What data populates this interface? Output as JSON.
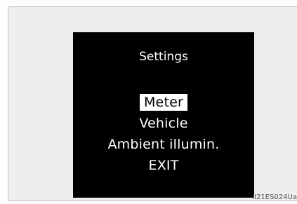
{
  "screen": {
    "title": "Settings",
    "menu": [
      {
        "label": "Meter",
        "selected": true
      },
      {
        "label": "Vehicle",
        "selected": false
      },
      {
        "label": "Ambient illumin.",
        "selected": false
      },
      {
        "label": "EXIT",
        "selected": false
      }
    ]
  },
  "figure_code": "II21ES024Ua",
  "colors": {
    "screen_background": "#000000",
    "text": "#ffffff",
    "highlight": "#ffffff",
    "frame_background": "#eeeeee"
  }
}
